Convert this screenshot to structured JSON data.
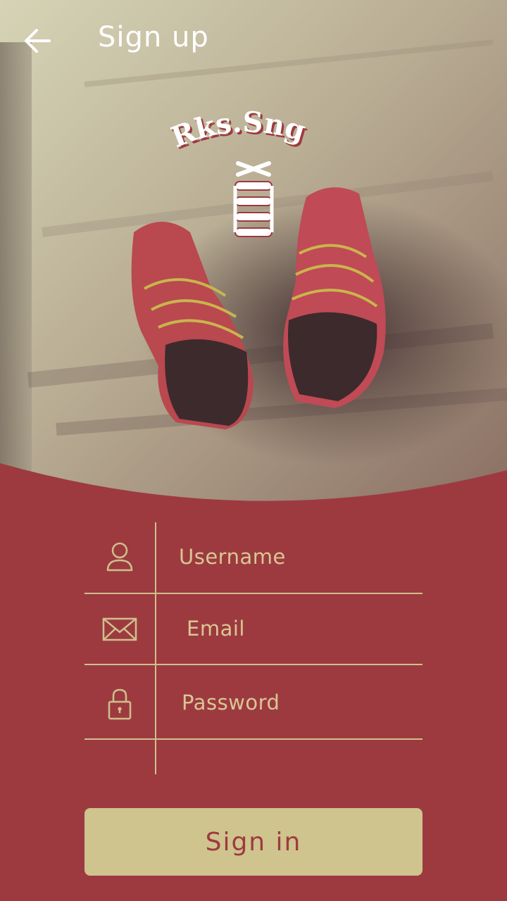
{
  "header": {
    "title": "Sign up",
    "back_icon": "arrow-left-icon"
  },
  "logo": {
    "text": "Rks.Sng"
  },
  "form": {
    "fields": [
      {
        "name": "username",
        "placeholder": "Username",
        "icon": "user-icon"
      },
      {
        "name": "email",
        "placeholder": "Email",
        "icon": "envelope-icon"
      },
      {
        "name": "password",
        "placeholder": "Password",
        "icon": "lock-icon"
      }
    ]
  },
  "actions": {
    "signin_label": "Sign in"
  },
  "colors": {
    "primary": "#9d3a40",
    "accent": "#cfc38e",
    "line": "#cfbf8c"
  }
}
